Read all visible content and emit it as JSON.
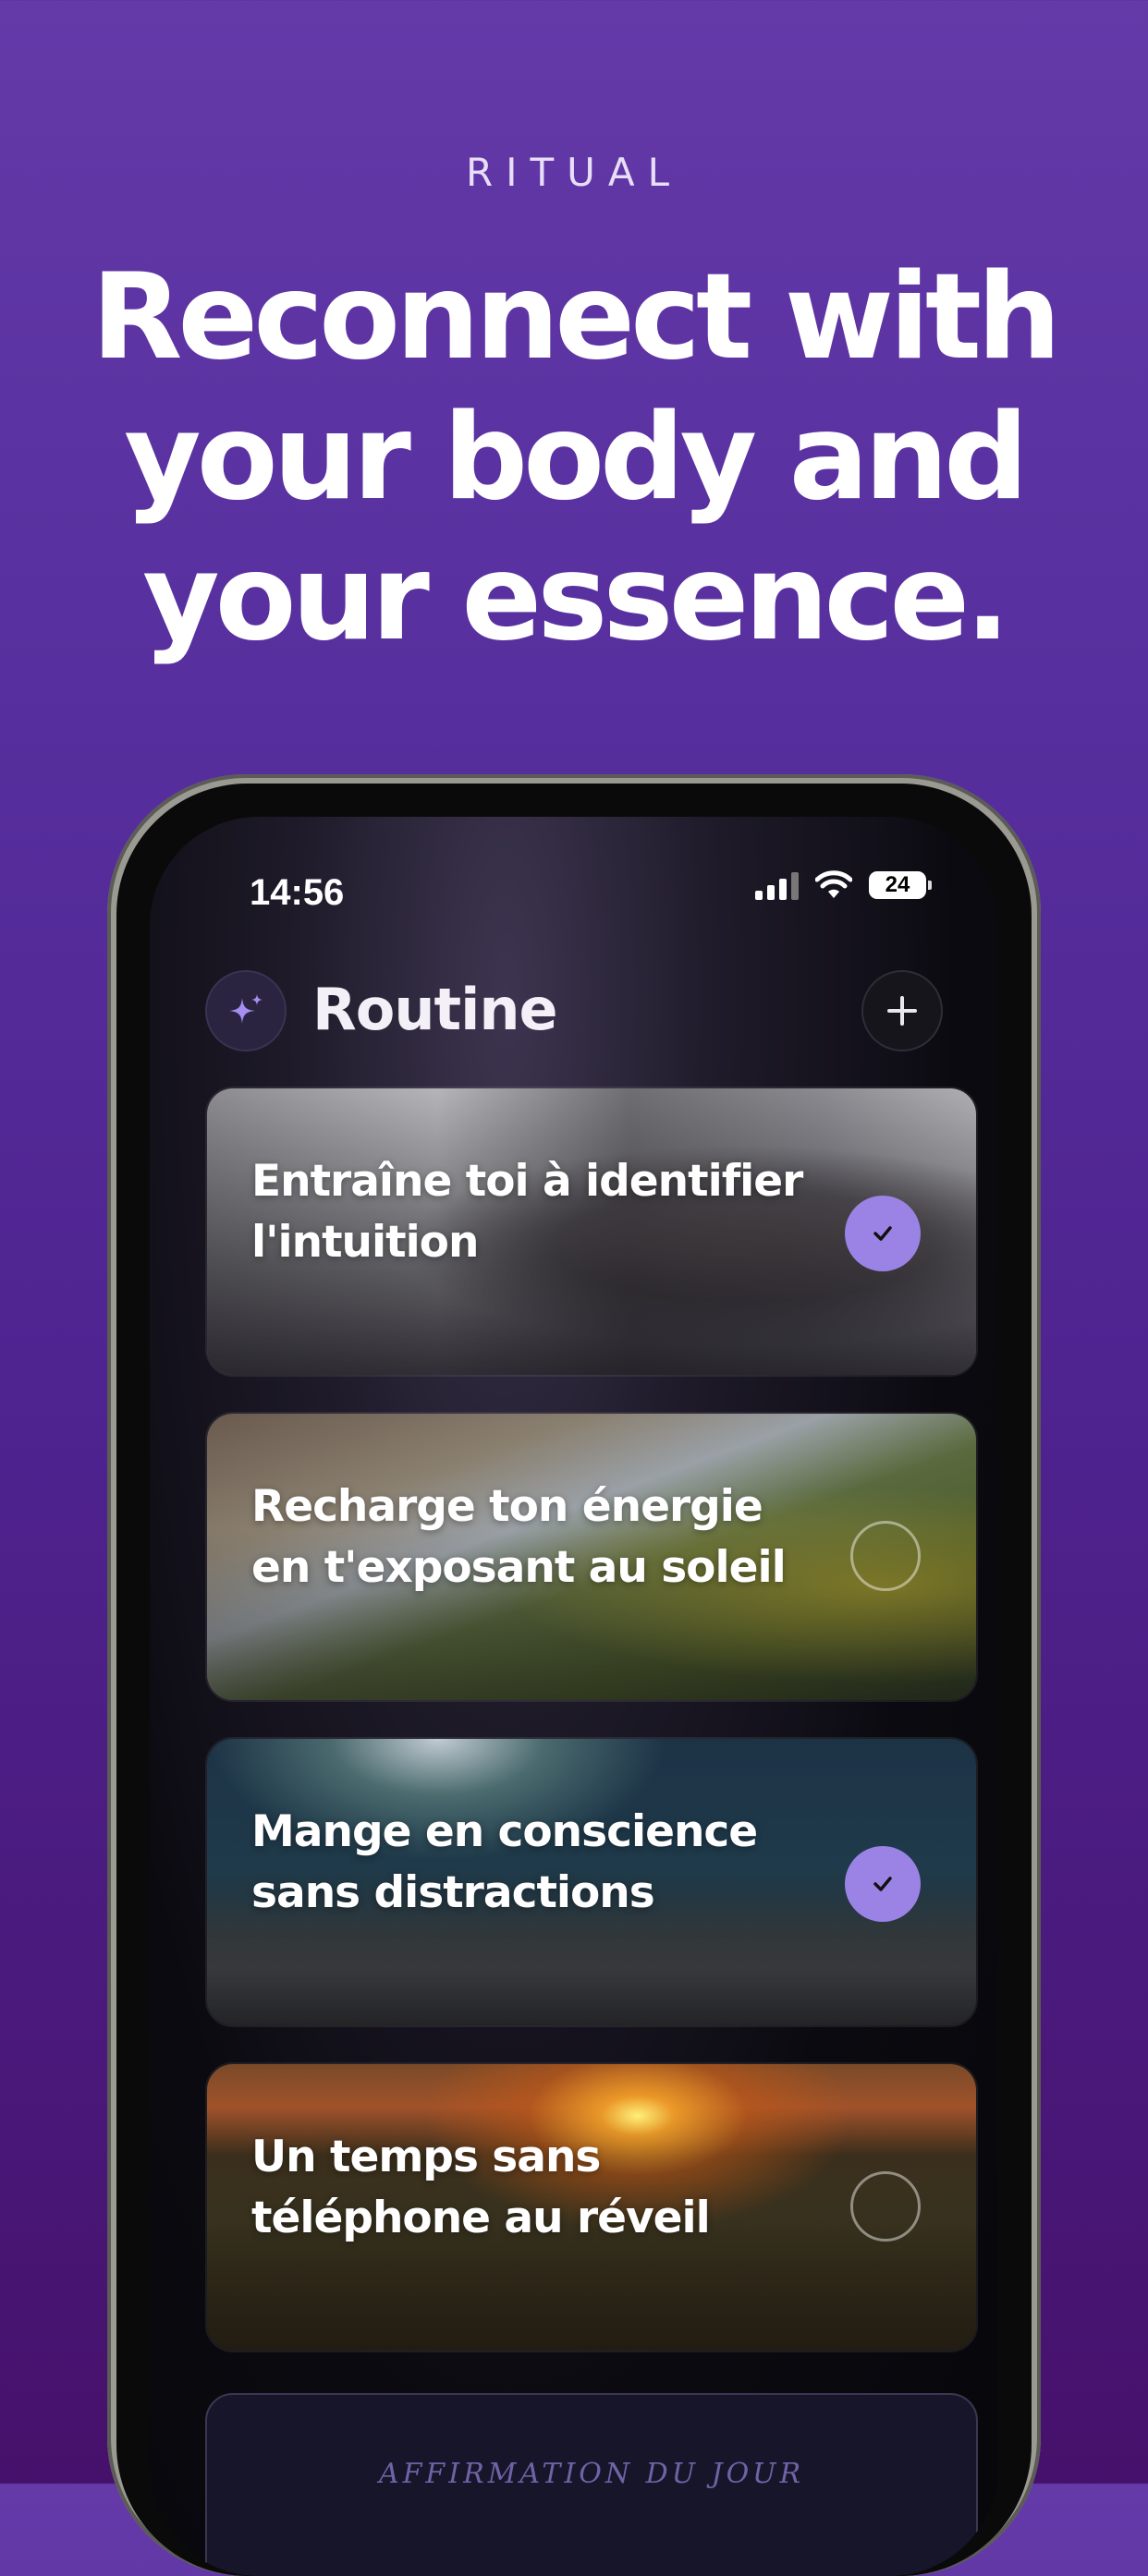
{
  "hero": {
    "brand": "RITUAL",
    "headline_lines": [
      "Reconnect with",
      "your body and",
      "your essence."
    ]
  },
  "status_bar": {
    "time": "14:56",
    "battery": "24"
  },
  "header": {
    "title": "Routine",
    "left_icon": "sparkle-icon",
    "right_icon": "plus-icon"
  },
  "routine": [
    {
      "title_lines": [
        "Entraîne toi à identifier",
        "l'intuition"
      ],
      "completed": true
    },
    {
      "title_lines": [
        "Recharge ton énergie",
        "en t'exposant au soleil"
      ],
      "completed": false
    },
    {
      "title_lines": [
        "Mange en conscience",
        "sans distractions"
      ],
      "completed": true
    },
    {
      "title_lines": [
        "Un temps sans",
        "téléphone au réveil"
      ],
      "completed": false
    }
  ],
  "affirmation": {
    "label": "AFFIRMATION DU JOUR"
  },
  "colors": {
    "background_top": "#6439a8",
    "background_bottom": "#46116b",
    "accent": "#9b83e6"
  }
}
